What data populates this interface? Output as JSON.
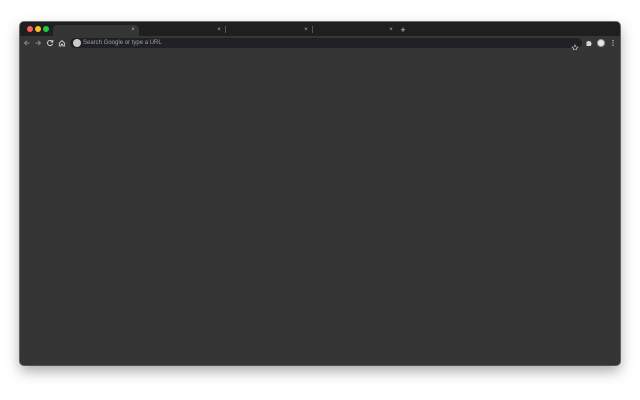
{
  "window": {
    "controls": {
      "close_color": "#fe5f57",
      "minimize_color": "#febc2e",
      "maximize_color": "#28c840"
    }
  },
  "tabs": [
    {
      "title": "",
      "close_glyph": "×",
      "active": true
    },
    {
      "title": "",
      "close_glyph": "×",
      "active": false
    },
    {
      "title": "",
      "close_glyph": "×",
      "active": false
    },
    {
      "title": "",
      "close_glyph": "×",
      "active": false
    }
  ],
  "new_tab_glyph": "+",
  "toolbar": {
    "back_icon": "back-arrow-icon",
    "forward_icon": "forward-arrow-icon",
    "reload_icon": "reload-icon",
    "home_icon": "home-icon",
    "extensions_icon": "puzzle-icon",
    "menu_icon": "kebab-menu-icon"
  },
  "omnibox": {
    "placeholder": "Search Google or type a URL",
    "value": "",
    "leading_icon": "google-g-icon",
    "bookmark_icon": "star-icon"
  },
  "colors": {
    "tabstrip": "#1f1f1f",
    "toolbar": "#353535",
    "omnibox": "#202124",
    "content": "#353535"
  }
}
